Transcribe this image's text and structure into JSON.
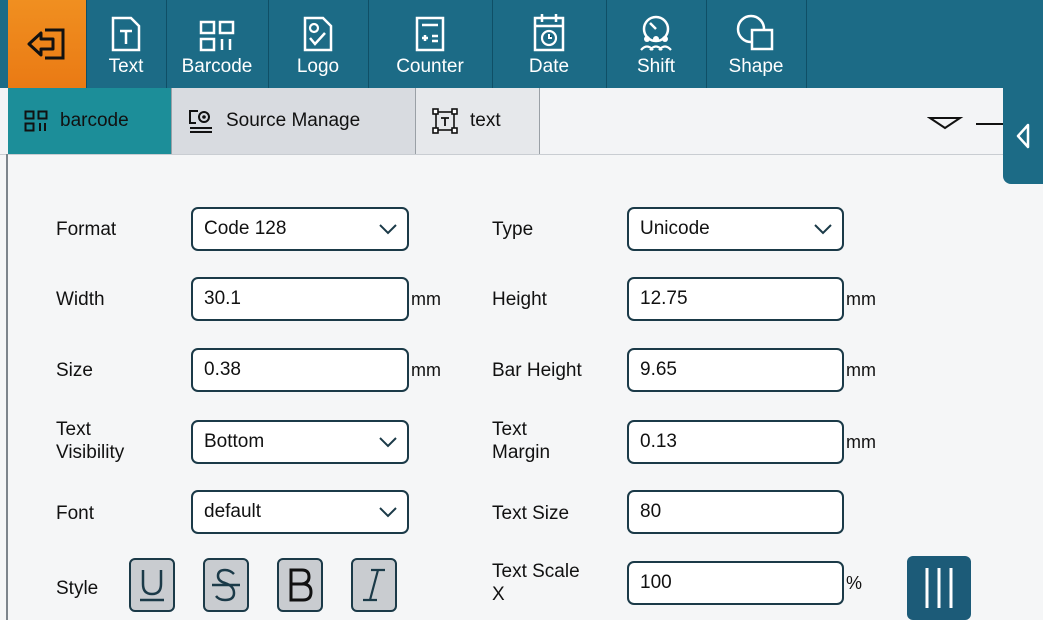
{
  "toolbar": {
    "items": [
      {
        "label": "Text",
        "icon": "text-icon"
      },
      {
        "label": "Barcode",
        "icon": "barcode-icon"
      },
      {
        "label": "Logo",
        "icon": "logo-icon"
      },
      {
        "label": "Counter",
        "icon": "counter-icon"
      },
      {
        "label": "Date",
        "icon": "date-icon"
      },
      {
        "label": "Shift",
        "icon": "shift-icon"
      },
      {
        "label": "Shape",
        "icon": "shape-icon"
      }
    ]
  },
  "tabs": [
    {
      "label": "barcode",
      "icon": "barcode-icon",
      "active": true
    },
    {
      "label": "Source Manage",
      "icon": "source-manage-icon"
    },
    {
      "label": "text",
      "icon": "text-frame-icon"
    }
  ],
  "form": {
    "format": {
      "label": "Format",
      "value": "Code 128"
    },
    "type": {
      "label": "Type",
      "value": "Unicode"
    },
    "width": {
      "label": "Width",
      "value": "30.1",
      "unit": "mm"
    },
    "height": {
      "label": "Height",
      "value": "12.75",
      "unit": "mm"
    },
    "size": {
      "label": "Size",
      "value": "0.38",
      "unit": "mm"
    },
    "bar_height": {
      "label": "Bar Height",
      "value": "9.65",
      "unit": "mm"
    },
    "text_visibility": {
      "label_line1": "Text",
      "label_line2": "Visibility",
      "value": "Bottom"
    },
    "text_margin": {
      "label_line1": "Text",
      "label_line2": "Margin",
      "value": "0.13",
      "unit": "mm"
    },
    "font": {
      "label": "Font",
      "value": "default"
    },
    "text_size": {
      "label": "Text Size",
      "value": "80"
    },
    "style": {
      "label": "Style"
    },
    "text_scale_x": {
      "label_line1": "Text Scale",
      "label_line2": "X",
      "value": "100",
      "unit": "%"
    }
  },
  "colors": {
    "accent_orange": "#ea7a14",
    "toolbar_blue": "#1c6b86",
    "tab_teal": "#1c8e99",
    "field_border": "#1b3a48"
  }
}
